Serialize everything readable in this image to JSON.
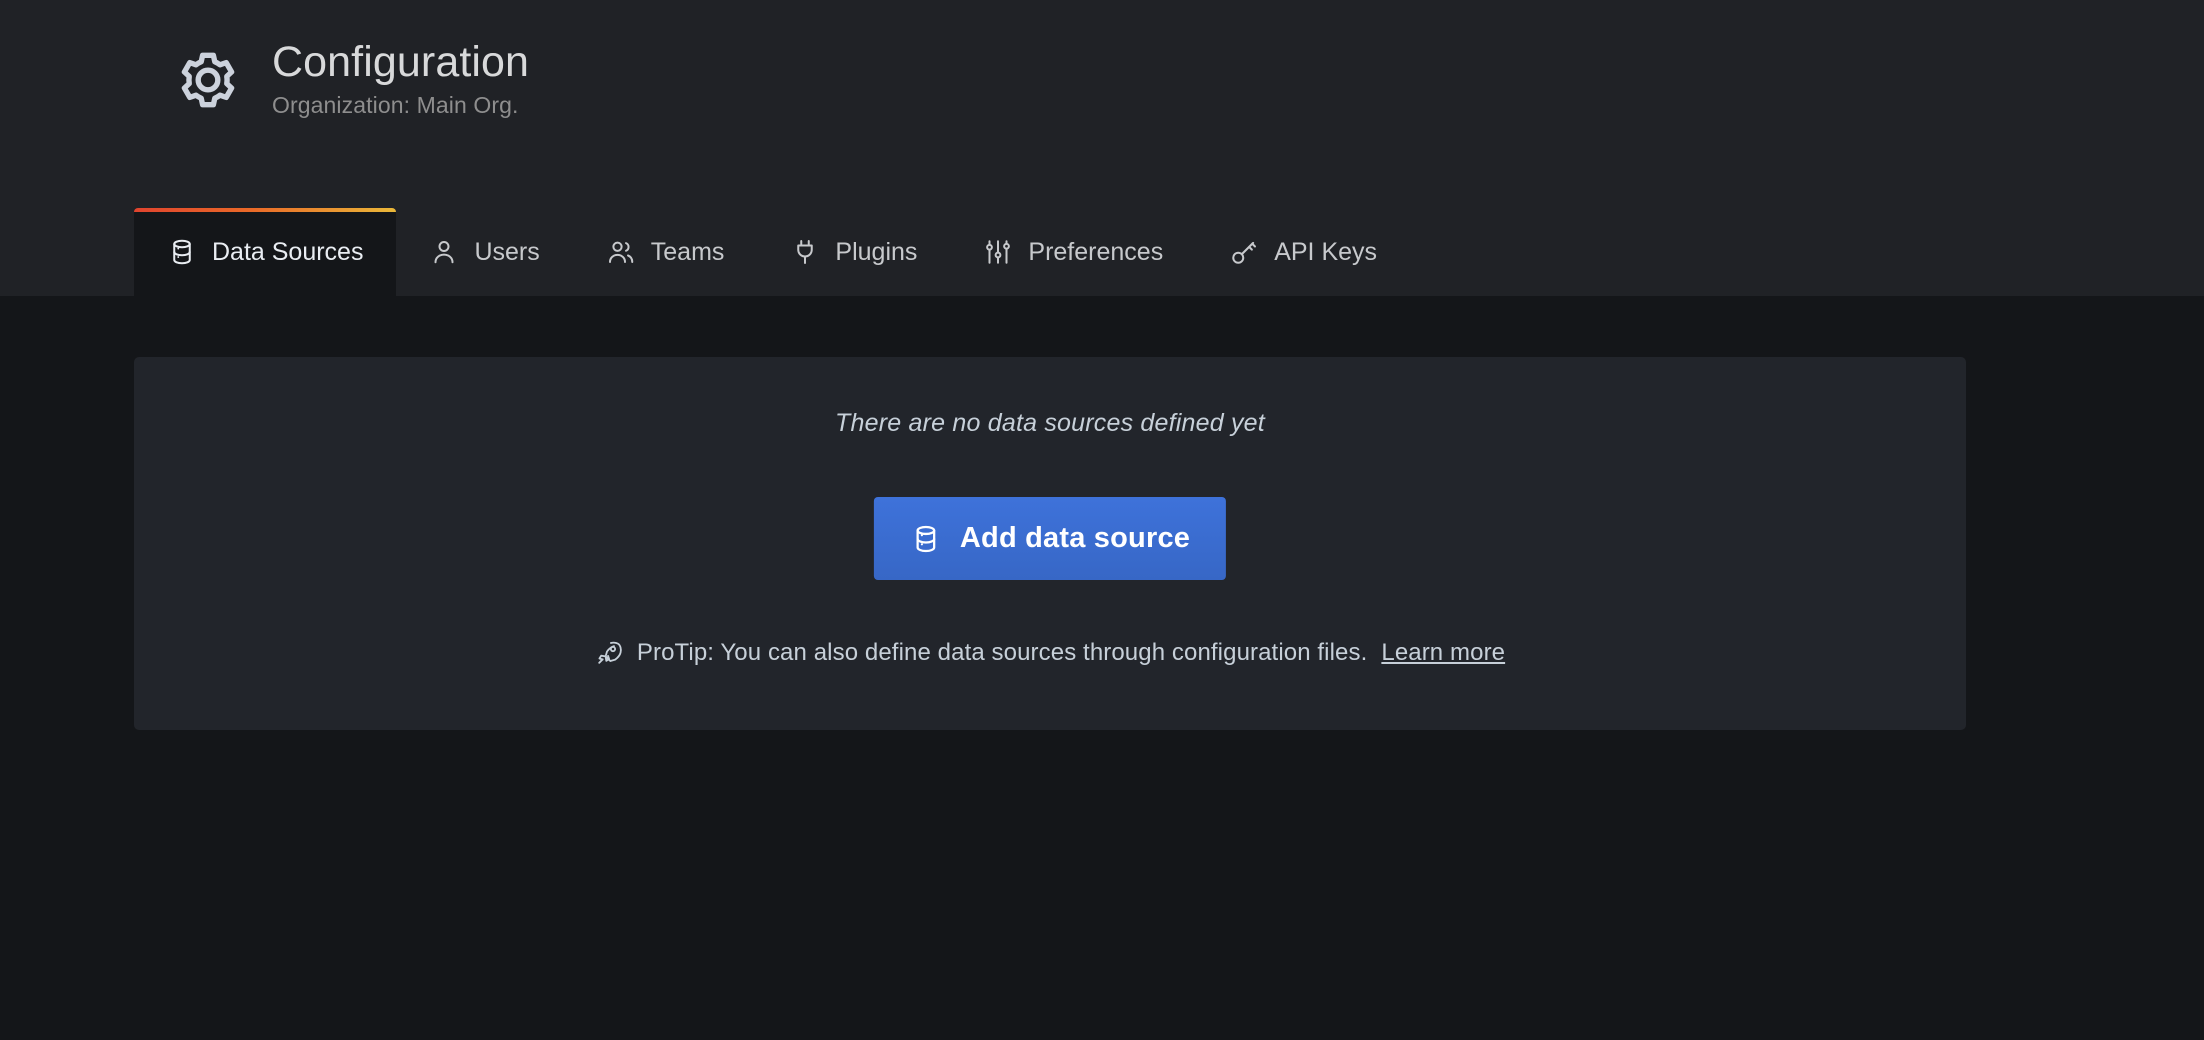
{
  "header": {
    "icon": "gear-icon",
    "title": "Configuration",
    "subtitle": "Organization: Main Org."
  },
  "tabs": [
    {
      "label": "Data Sources",
      "icon": "database-icon",
      "active": true
    },
    {
      "label": "Users",
      "icon": "user-icon",
      "active": false
    },
    {
      "label": "Teams",
      "icon": "users-group-icon",
      "active": false
    },
    {
      "label": "Plugins",
      "icon": "plug-icon",
      "active": false
    },
    {
      "label": "Preferences",
      "icon": "sliders-icon",
      "active": false
    },
    {
      "label": "API Keys",
      "icon": "key-icon",
      "active": false
    }
  ],
  "main": {
    "empty_message": "There are no data sources defined yet",
    "add_button_label": "Add data source",
    "add_button_icon": "database-icon",
    "protip_icon": "rocket-icon",
    "protip_text": "ProTip: You can also define data sources through configuration files.",
    "protip_link_label": "Learn more"
  },
  "colors": {
    "page_background": "#141619",
    "header_background": "#202226",
    "panel_background": "#22252b",
    "primary_button": "#3e72da",
    "accent_gradient_start": "#e0442e",
    "accent_gradient_end": "#eab839",
    "text_primary": "#d8d9da",
    "text_secondary": "#8e8e8e"
  }
}
